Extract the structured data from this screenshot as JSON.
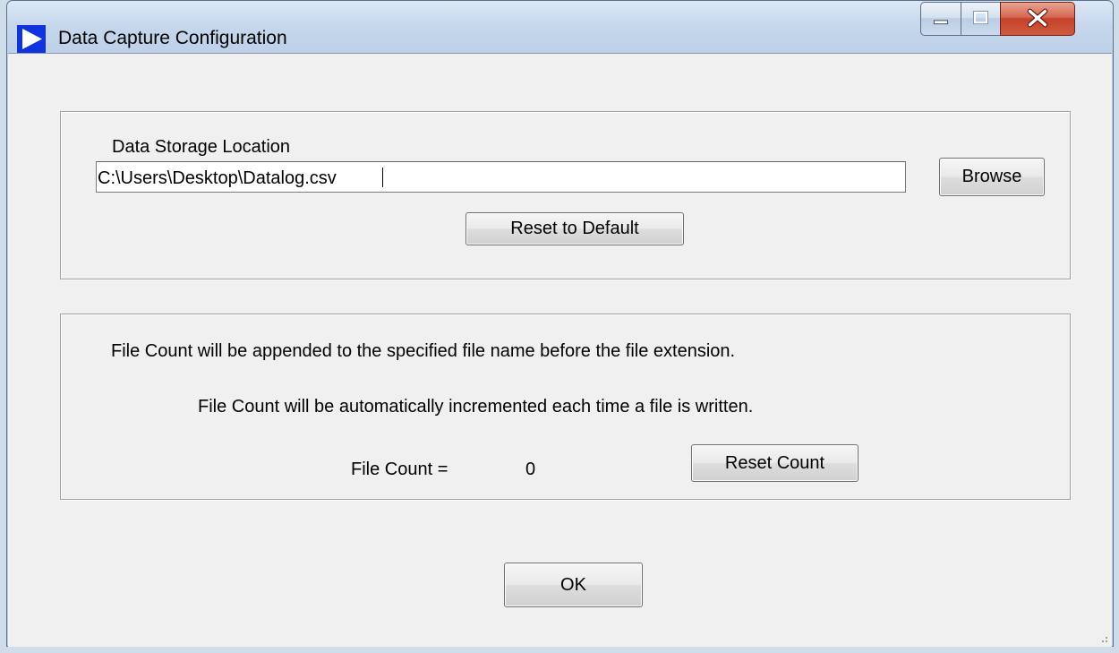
{
  "window": {
    "title": "Data Capture Configuration",
    "icon": "play-triangle-icon",
    "controls": {
      "minimize": "minimize-icon",
      "maximize": "maximize-icon",
      "close": "close-icon"
    }
  },
  "storage": {
    "label": "Data Storage Location",
    "path_value": "C:\\Users\\Desktop\\Datalog.csv",
    "browse_label": "Browse",
    "reset_default_label": "Reset to Default"
  },
  "file_count": {
    "info_line_1": "File Count will be appended to the specified file name before the file extension.",
    "info_line_2": "File Count will be automatically incremented each time a file is written.",
    "count_label": "File Count =",
    "count_value": "0",
    "reset_count_label": "Reset Count"
  },
  "footer": {
    "ok_label": "OK"
  },
  "colors": {
    "app_icon_blue": "#1033e0",
    "client_background": "#f0f0f0",
    "close_button_red": "#c4412a"
  }
}
